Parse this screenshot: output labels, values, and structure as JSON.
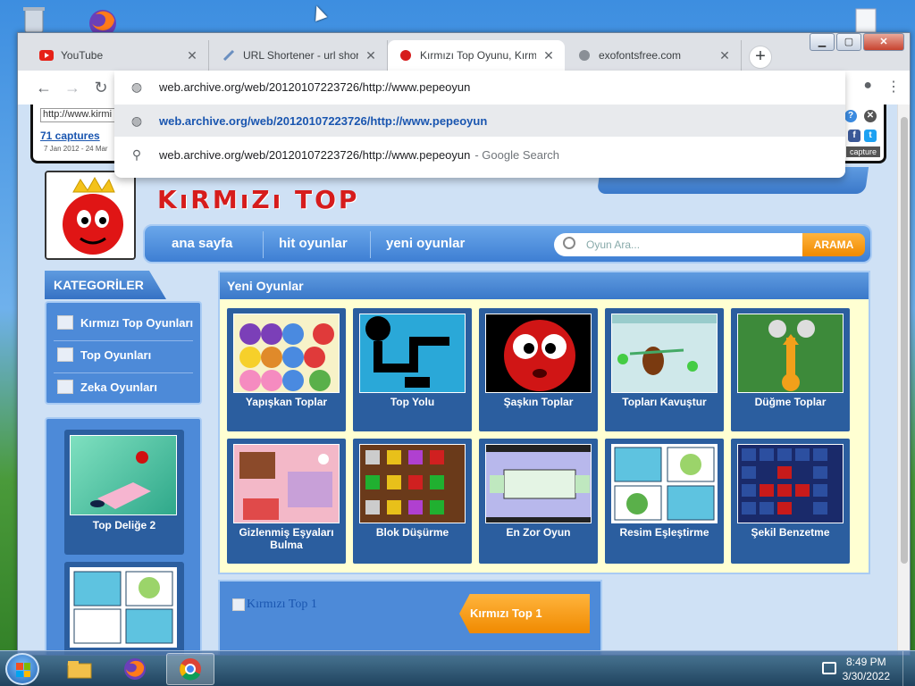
{
  "browser": {
    "tabs": [
      {
        "title": "YouTube",
        "icon": "youtube-icon",
        "active": false
      },
      {
        "title": "URL Shortener - url shorte",
        "icon": "url-shortener-icon",
        "active": false
      },
      {
        "title": "Kırmızı Top Oyunu, Kırmız",
        "icon": "red-ball-icon",
        "active": true
      },
      {
        "title": "exofontsfree.com",
        "icon": "globe-icon",
        "active": false
      }
    ],
    "new_tab": "+",
    "window_controls": {
      "minimize": "▁",
      "maximize": "▢",
      "close": "✕"
    },
    "omnibox": {
      "typed": "web.archive.org/web/20120107223726/http://www.pepeoyun",
      "suggestions": [
        {
          "icon": "globe-icon",
          "text": "web.archive.org/web/20120107223726/http://www.pepeoyun",
          "selected": true
        },
        {
          "icon": "search-icon",
          "text": "web.archive.org/web/20120107223726/http://www.pepeoyun",
          "suffix": "- Google Search",
          "selected": false
        }
      ]
    }
  },
  "wayback": {
    "url_field": "http://www.kirmi",
    "captures": "71 captures",
    "dates": "7 Jan 2012 - 24 Mar",
    "capture_btn": "capture"
  },
  "site": {
    "brand": "KıRMıZı TOP",
    "nav": [
      "ana sayfa",
      "hit oyunlar",
      "yeni oyunlar"
    ],
    "search_placeholder": "Oyun Ara...",
    "search_button": "ARAMA",
    "categories_title": "KATEGORİLER",
    "categories": [
      "Kırmızı Top Oyunları",
      "Top Oyunları",
      "Zeka Oyunları"
    ],
    "sidebar_games": [
      "Top Deliğe 2"
    ],
    "new_games_title": "Yeni Oyunlar",
    "games": [
      "Yapışkan Toplar",
      "Top Yolu",
      "Şaşkın Toplar",
      "Topları Kavuştur",
      "Düğme Toplar",
      "Gizlenmiş Eşyaları Bulma",
      "Blok Düşürme",
      "En Zor Oyun",
      "Resim Eşleştirme",
      "Şekil Benzetme"
    ],
    "featured_alt": "Kırmızı Top 1",
    "featured_button": "Kırmızı Top 1"
  },
  "taskbar": {
    "time": "8:49 PM",
    "date": "3/30/2022",
    "apps": [
      "file-explorer-icon",
      "firefox-icon",
      "chrome-icon"
    ]
  },
  "colors": {
    "accent_blue": "#3a78c9",
    "orange": "#f08a00",
    "brand_red": "#d61c1c"
  }
}
